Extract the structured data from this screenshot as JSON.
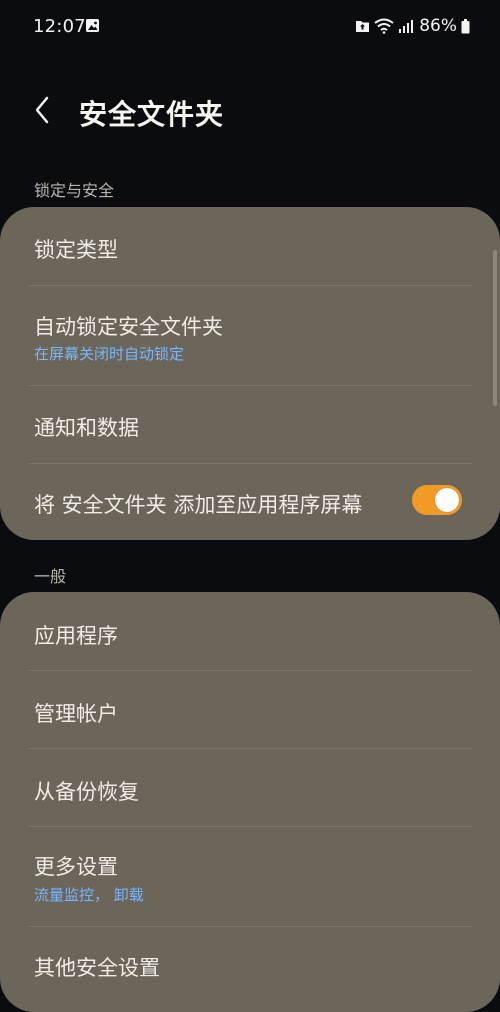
{
  "status_bar": {
    "time": "12:07",
    "battery": "86%"
  },
  "app_bar": {
    "title": "安全文件夹"
  },
  "sections": [
    {
      "header": "锁定与安全",
      "items": [
        {
          "title": "锁定类型"
        },
        {
          "title": "自动锁定安全文件夹",
          "subtitle": "在屏幕关闭时自动锁定"
        },
        {
          "title": "通知和数据"
        },
        {
          "title": "将 安全文件夹 添加至应用程序屏幕",
          "toggle": true
        }
      ]
    },
    {
      "header": "一般",
      "items": [
        {
          "title": "应用程序"
        },
        {
          "title": "管理帐户"
        },
        {
          "title": "从备份恢复"
        },
        {
          "title": "更多设置",
          "subtitle": "流量监控， 卸载"
        },
        {
          "title": "其他安全设置"
        }
      ]
    }
  ],
  "colors": {
    "background": "#0b0c10",
    "card": "#6c6559",
    "accent_toggle": "#f29a26",
    "subtitle": "#78b7ff"
  }
}
